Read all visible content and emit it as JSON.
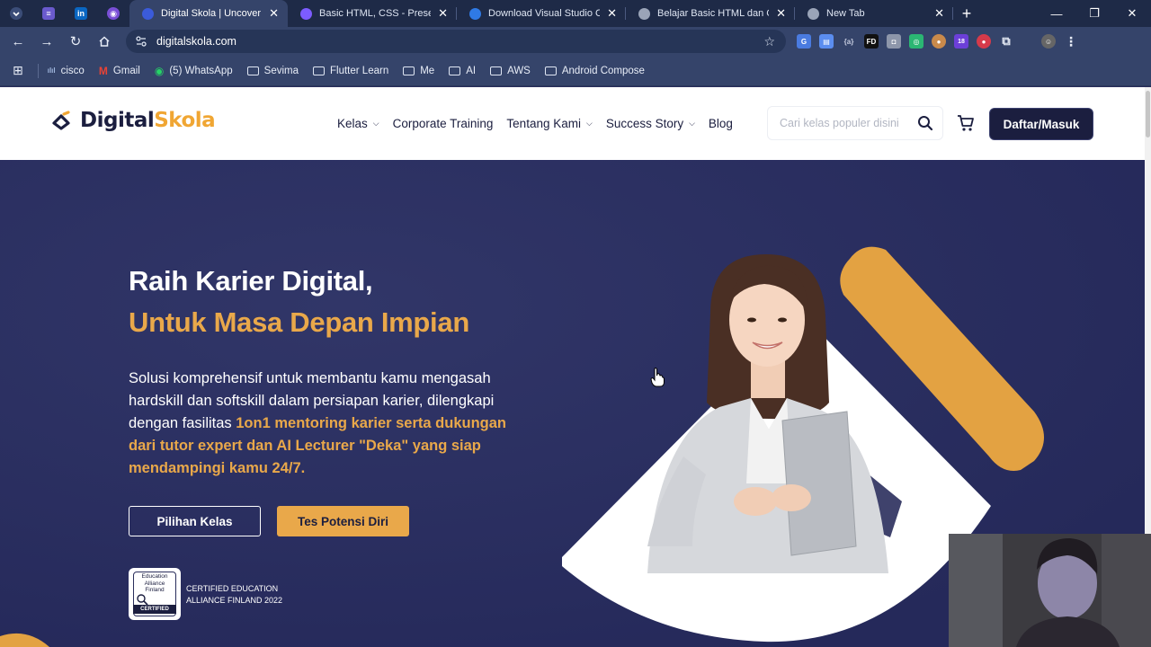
{
  "browser": {
    "tabs": [
      {
        "title": "Digital Skola | Uncover the",
        "active": true,
        "favicon_color": "#3b5bdb"
      },
      {
        "title": "Basic HTML, CSS - Present",
        "active": false,
        "favicon_color": "#7c5cff"
      },
      {
        "title": "Download Visual Studio C",
        "active": false,
        "favicon_color": "#2f7ae5"
      },
      {
        "title": "Belajar Basic HTML dan C",
        "active": false,
        "favicon_color": "#9aa4b8"
      },
      {
        "title": "New Tab",
        "active": false,
        "favicon_color": "#9aa4b8"
      }
    ],
    "url": "digitalskola.com",
    "bookmarks": [
      {
        "label": "cisco",
        "icon": "cisco-icon"
      },
      {
        "label": "Gmail",
        "icon": "gmail-icon"
      },
      {
        "label": "(5) WhatsApp",
        "icon": "whatsapp-icon"
      },
      {
        "label": "Sevima",
        "icon": "folder-icon"
      },
      {
        "label": "Flutter Learn",
        "icon": "folder-icon"
      },
      {
        "label": "Me",
        "icon": "folder-icon"
      },
      {
        "label": "AI",
        "icon": "folder-icon"
      },
      {
        "label": "AWS",
        "icon": "folder-icon"
      },
      {
        "label": "Android Compose",
        "icon": "folder-icon"
      }
    ],
    "extension_badge": "18",
    "extension_fd": "FD"
  },
  "site": {
    "logo": {
      "part1": "Digital",
      "part2": "Skola"
    },
    "nav": [
      {
        "label": "Kelas",
        "dropdown": true
      },
      {
        "label": "Corporate Training",
        "dropdown": false
      },
      {
        "label": "Tentang Kami",
        "dropdown": true
      },
      {
        "label": "Success Story",
        "dropdown": true
      },
      {
        "label": "Blog",
        "dropdown": false
      }
    ],
    "search_placeholder": "Cari kelas populer disini",
    "login_label": "Daftar/Masuk"
  },
  "hero": {
    "headline_line1": "Raih Karier Digital,",
    "headline_line2": "Untuk Masa Depan Impian",
    "description_plain": "Solusi komprehensif untuk membantu kamu mengasah hardskill dan softskill dalam persiapan karier, dilengkapi dengan fasilitas ",
    "description_highlight": "1on1 mentoring karier serta dukungan dari tutor expert dan AI Lecturer \"Deka\" yang siap mendampingi kamu 24/7.",
    "primary_button": "Pilihan Kelas",
    "secondary_button": "Tes Potensi Diri",
    "certification": {
      "badge_lines": [
        "Education",
        "Alliance",
        "Finland"
      ],
      "badge_ribbon": "CERTIFIED",
      "text_line1": "CERTIFIED EDUCATION",
      "text_line2": "ALLIANCE FINLAND 2022"
    }
  },
  "colors": {
    "brand_navy": "#1b1e3f",
    "hero_bg": "#2a2e5c",
    "accent_gold": "#e9a84a",
    "logo_gold": "#f0a633"
  }
}
